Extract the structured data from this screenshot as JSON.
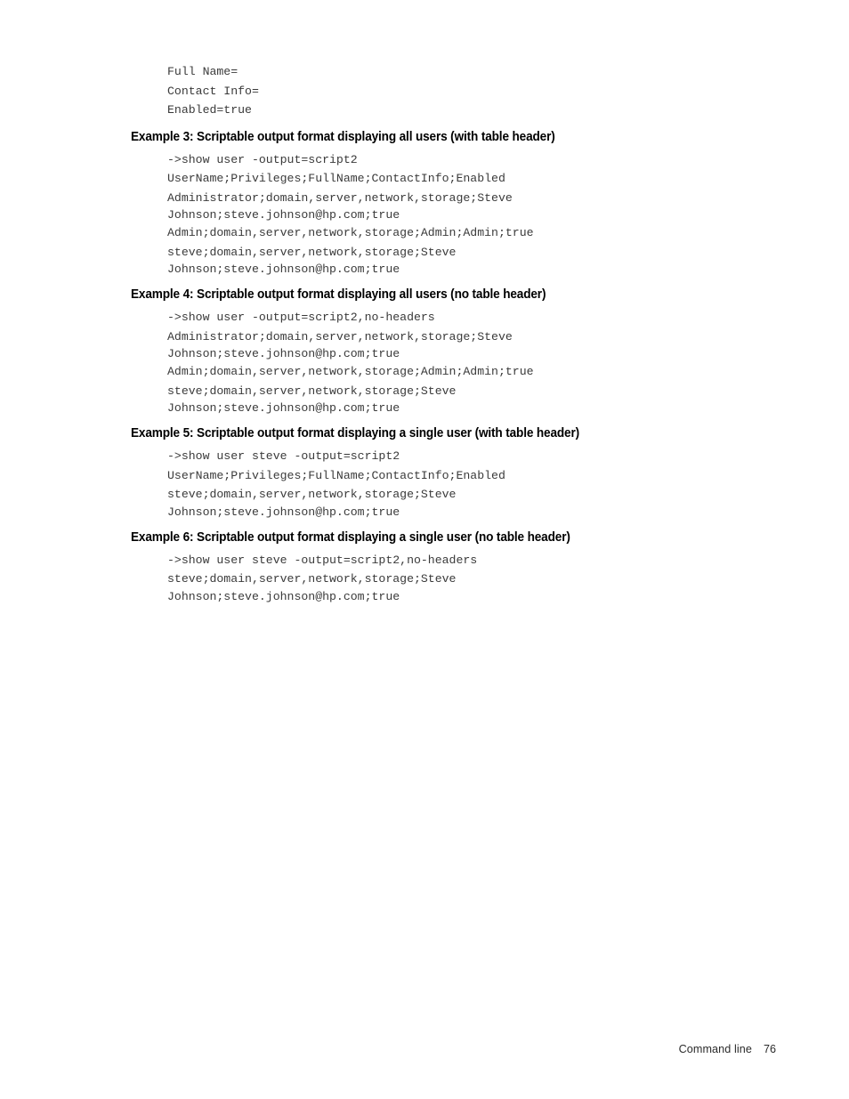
{
  "document": {
    "footer": {
      "section_label": "Command line",
      "page_number": "76"
    }
  },
  "top_output": {
    "lines": [
      "Full Name=",
      "Contact Info=",
      "Enabled=true"
    ]
  },
  "examples": [
    {
      "heading": "Example 3: Scriptable output format displaying all users (with table header)",
      "lines": [
        {
          "text": "->show user -output=script2",
          "cont": false
        },
        {
          "text": "UserName;Privileges;FullName;ContactInfo;Enabled",
          "cont": false
        },
        {
          "text": "Administrator;domain,server,network,storage;Steve",
          "cont": false
        },
        {
          "text": "Johnson;steve.johnson@hp.com;true",
          "cont": true
        },
        {
          "text": "Admin;domain,server,network,storage;Admin;Admin;true",
          "cont": false
        },
        {
          "text": "steve;domain,server,network,storage;Steve",
          "cont": false
        },
        {
          "text": "Johnson;steve.johnson@hp.com;true",
          "cont": true
        }
      ]
    },
    {
      "heading": "Example 4: Scriptable output format displaying all users (no table header)",
      "lines": [
        {
          "text": "->show user -output=script2,no-headers",
          "cont": false
        },
        {
          "text": "Administrator;domain,server,network,storage;Steve",
          "cont": false
        },
        {
          "text": "Johnson;steve.johnson@hp.com;true",
          "cont": true
        },
        {
          "text": "Admin;domain,server,network,storage;Admin;Admin;true",
          "cont": false
        },
        {
          "text": "steve;domain,server,network,storage;Steve",
          "cont": false
        },
        {
          "text": "Johnson;steve.johnson@hp.com;true",
          "cont": true
        }
      ]
    },
    {
      "heading": "Example 5: Scriptable output format displaying a single user (with table header)",
      "lines": [
        {
          "text": "->show user steve -output=script2",
          "cont": false
        },
        {
          "text": "UserName;Privileges;FullName;ContactInfo;Enabled",
          "cont": false
        },
        {
          "text": "steve;domain,server,network,storage;Steve",
          "cont": false
        },
        {
          "text": "Johnson;steve.johnson@hp.com;true",
          "cont": true
        }
      ]
    },
    {
      "heading": "Example 6: Scriptable output format displaying a single user (no table header)",
      "lines": [
        {
          "text": "->show user steve -output=script2,no-headers",
          "cont": false
        },
        {
          "text": "steve;domain,server,network,storage;Steve",
          "cont": false
        },
        {
          "text": "Johnson;steve.johnson@hp.com;true",
          "cont": true
        }
      ]
    }
  ]
}
